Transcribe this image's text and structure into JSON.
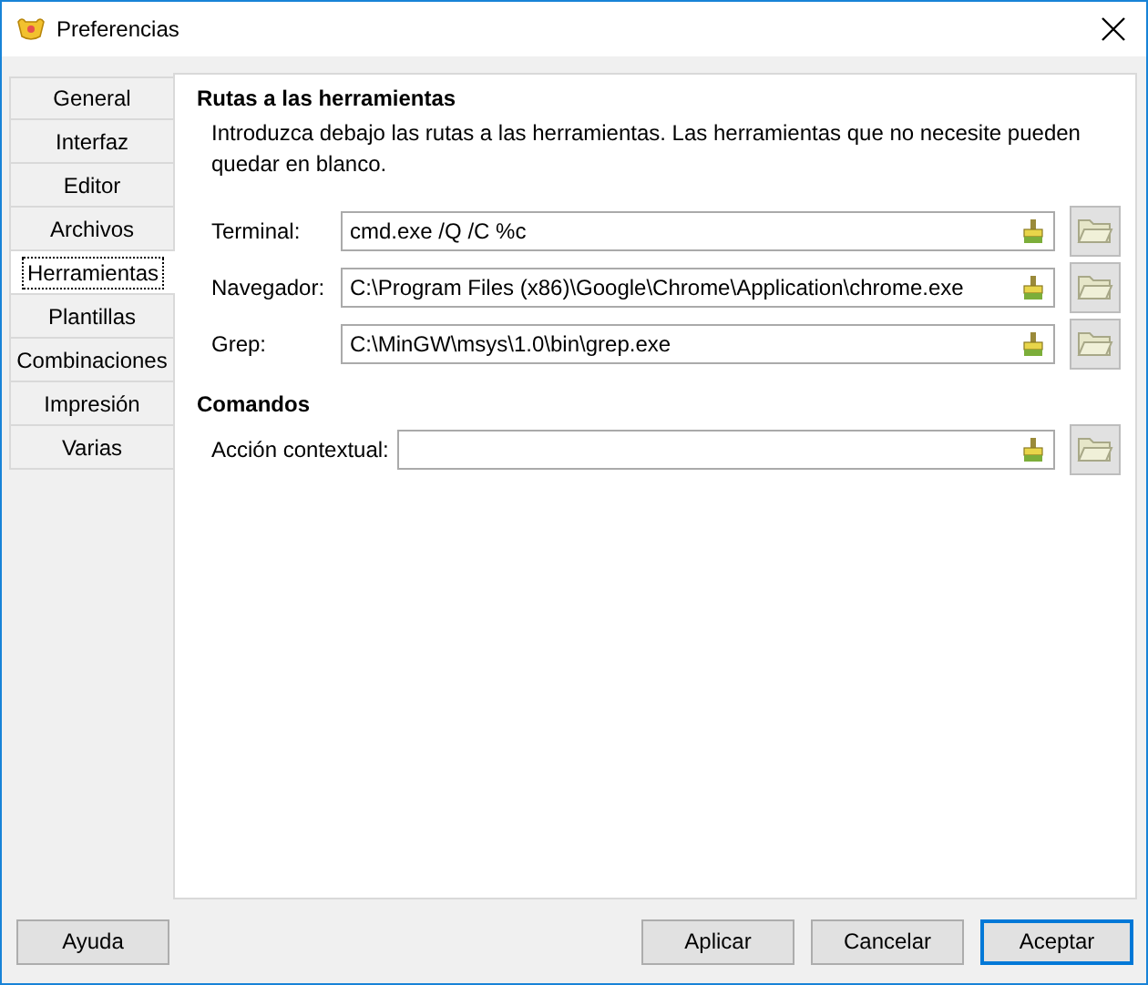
{
  "window": {
    "title": "Preferencias"
  },
  "tabs": [
    {
      "label": "General",
      "selected": false
    },
    {
      "label": "Interfaz",
      "selected": false
    },
    {
      "label": "Editor",
      "selected": false
    },
    {
      "label": "Archivos",
      "selected": false
    },
    {
      "label": "Herramientas",
      "selected": true
    },
    {
      "label": "Plantillas",
      "selected": false
    },
    {
      "label": "Combinaciones",
      "selected": false
    },
    {
      "label": "Impresión",
      "selected": false
    },
    {
      "label": "Varias",
      "selected": false
    }
  ],
  "sections": [
    {
      "title": "Rutas a las herramientas",
      "description": "Introduzca debajo las rutas a las herramientas. Las herramientas que no necesite pueden quedar en blanco.",
      "fields": [
        {
          "label": "Terminal:",
          "value": "cmd.exe /Q /C %c"
        },
        {
          "label": "Navegador:",
          "value": "C:\\Program Files (x86)\\Google\\Chrome\\Application\\chrome.exe"
        },
        {
          "label": "Grep:",
          "value": "C:\\MinGW\\msys\\1.0\\bin\\grep.exe"
        }
      ]
    },
    {
      "title": "Comandos",
      "fields": [
        {
          "label": "Acción contextual:"
        }
      ]
    }
  ],
  "left_buttons": [
    {
      "label": "Ayuda",
      "default": false
    }
  ],
  "right_buttons": [
    {
      "label": "Aplicar",
      "default": false
    },
    {
      "label": "Cancelar",
      "default": false
    },
    {
      "label": "Aceptar",
      "default": true
    }
  ]
}
